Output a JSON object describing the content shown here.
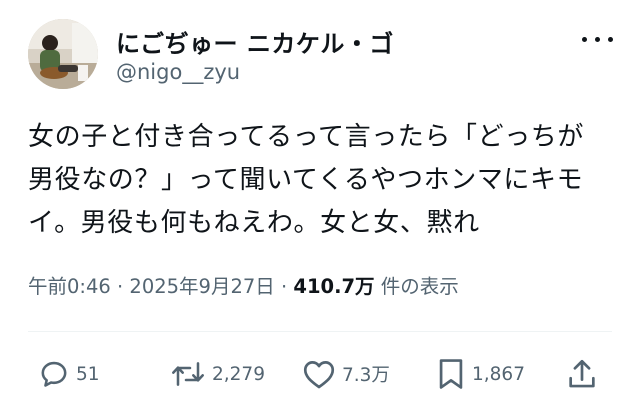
{
  "author": {
    "display_name": "にごぢゅー ニカケル・ゴ",
    "handle": "@nigo__zyu"
  },
  "tweet": {
    "lines": [
      "女の子と付き合ってるって言ったら「どっちが",
      "男役なの？」って聞いてくるやつホンマにキモ",
      "イ。男役も何もねえわ。女と女、黙れ"
    ]
  },
  "meta": {
    "time": "午前0:46",
    "separator": " · ",
    "date": "2025年9月27日",
    "views": "410.7万",
    "views_label": "件の表示"
  },
  "actions": {
    "replies": "51",
    "reposts": "2,279",
    "likes": "7.3万",
    "bookmarks": "1,867"
  },
  "icons": [
    "more-icon",
    "reply-icon",
    "repost-icon",
    "like-icon",
    "bookmark-icon",
    "share-icon"
  ]
}
